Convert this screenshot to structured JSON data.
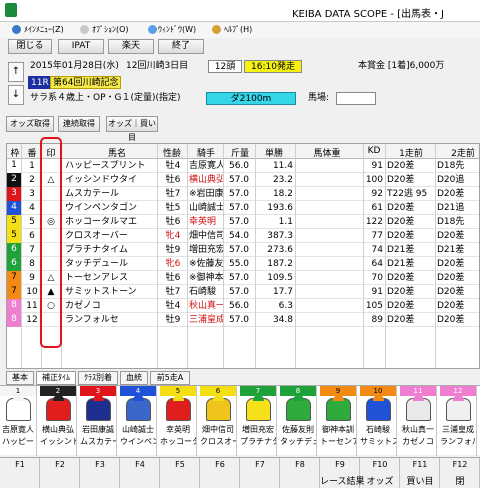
{
  "window": {
    "title": "KEIBA DATA SCOPE - [出馬表・J"
  },
  "menu": {
    "items": [
      "ﾒｲﾝﾒﾆｭｰ(Z)",
      "ｵﾌﾟｼｮﾝ(O)",
      "ｳｨﾝﾄﾞｳ(W)",
      "ﾍﾙﾌﾟ(H)"
    ]
  },
  "toolbar": {
    "close": "閉じる",
    "ipat": "IPAT",
    "rakuten": "楽天",
    "exit": "終了"
  },
  "race": {
    "date": "2015年01月28日(水)",
    "venue": "12回川崎3日目",
    "heads": "12頭",
    "start": "16:10発走",
    "prize": "本賞金 [1着]6,000万",
    "num": "11R",
    "name": "第64回川崎記念",
    "cond": "サラ系４歳上・OP・G１(定量)(指定)",
    "dist": "ダ2100m",
    "baba": "馬場:",
    "up": "↑",
    "down": "↓"
  },
  "subtabs": {
    "odds_get": "オッズ取得",
    "renzoku": "連続取得",
    "odds_buy": "オッズ｜買い目"
  },
  "grid": {
    "headers": [
      "枠",
      "番",
      "印",
      "馬名",
      "性齢",
      "騎手",
      "斤量",
      "単勝",
      "馬体重",
      "KD",
      "1走前",
      "2走前"
    ],
    "rows": [
      {
        "waku": "1",
        "ban": "1",
        "mark": "",
        "name": "ハッピースプリント",
        "sex": "牡4",
        "jockey": "吉原寛人",
        "kin": "56.0",
        "odds": "11.4",
        "kd": "91",
        "r1": "D20差",
        "r2": "D18先"
      },
      {
        "waku": "2",
        "ban": "2",
        "mark": "△",
        "name": "イッシンドウタイ",
        "sex": "牡6",
        "jockey": "横山典弘",
        "kin": "57.0",
        "odds": "23.2",
        "kd": "100",
        "r1": "D20差",
        "r2": "D20追"
      },
      {
        "waku": "3",
        "ban": "3",
        "mark": "",
        "name": "ムスカテール",
        "sex": "牡7",
        "jockey": "※岩田康誠",
        "kin": "57.0",
        "odds": "18.2",
        "kd": "92",
        "r1": "T22逃 95",
        "r2": "D20差"
      },
      {
        "waku": "4",
        "ban": "4",
        "mark": "",
        "name": "ウインペンタゴン",
        "sex": "牡5",
        "jockey": "山崎誠士",
        "kin": "57.0",
        "odds": "193.6",
        "kd": "61",
        "r1": "D20差",
        "r2": "D21追"
      },
      {
        "waku": "5",
        "ban": "5",
        "mark": "◎",
        "name": "ホッコータルマエ",
        "sex": "牡6",
        "jockey": "幸英明",
        "kin": "57.0",
        "odds": "1.1",
        "kd": "122",
        "r1": "D20差",
        "r2": "D18先"
      },
      {
        "waku": "5",
        "ban": "6",
        "mark": "",
        "name": "クロスオーバー",
        "sex": "牝4",
        "jockey": "畑中信司",
        "kin": "54.0",
        "odds": "387.3",
        "kd": "77",
        "r1": "D20差",
        "r2": "D20差"
      },
      {
        "waku": "6",
        "ban": "7",
        "mark": "",
        "name": "プラチナタイム",
        "sex": "牡9",
        "jockey": "増田充宏",
        "kin": "57.0",
        "odds": "273.6",
        "kd": "74",
        "r1": "D21差",
        "r2": "D21差"
      },
      {
        "waku": "6",
        "ban": "8",
        "mark": "",
        "name": "タッチデュール",
        "sex": "牝6",
        "jockey": "※佐藤友則",
        "kin": "55.0",
        "odds": "187.2",
        "kd": "64",
        "r1": "D21差",
        "r2": "D20差"
      },
      {
        "waku": "7",
        "ban": "9",
        "mark": "△",
        "name": "トーセンアレス",
        "sex": "牡6",
        "jockey": "※御神本訓",
        "kin": "57.0",
        "odds": "109.5",
        "kd": "70",
        "r1": "D20差",
        "r2": "D20差"
      },
      {
        "waku": "7",
        "ban": "10",
        "mark": "▲",
        "name": "サミットストーン",
        "sex": "牡7",
        "jockey": "石崎駿",
        "kin": "57.0",
        "odds": "17.7",
        "kd": "91",
        "r1": "D20差",
        "r2": "D20差"
      },
      {
        "waku": "8",
        "ban": "11",
        "mark": "○",
        "name": "カゼノコ",
        "sex": "牡4",
        "jockey": "秋山真一",
        "kin": "56.0",
        "odds": "6.3",
        "kd": "105",
        "r1": "D20差",
        "r2": "D20差"
      },
      {
        "waku": "8",
        "ban": "12",
        "mark": "",
        "name": "ランフォルセ",
        "sex": "牡9",
        "jockey": "三浦皇成",
        "kin": "57.0",
        "odds": "34.8",
        "kd": "89",
        "r1": "D20差",
        "r2": "D20差"
      }
    ]
  },
  "bottom_tabs": [
    "基本",
    "補正ﾀｲﾑ",
    "ｸﾗｽ別着",
    "血統",
    "前5走A"
  ],
  "silks": [
    {
      "n": "1",
      "jockey": "吉原寛人",
      "horse": "ハッピー"
    },
    {
      "n": "2",
      "jockey": "横山典弘",
      "horse": "イッシンド"
    },
    {
      "n": "3",
      "jockey": "岩田康誠",
      "horse": "ムスカテー"
    },
    {
      "n": "4",
      "jockey": "山崎誠士",
      "horse": "ウインペン"
    },
    {
      "n": "5",
      "jockey": "幸英明",
      "horse": "ホッコータ"
    },
    {
      "n": "6",
      "jockey": "畑中信司",
      "horse": "クロスオー"
    },
    {
      "n": "7",
      "jockey": "増田充宏",
      "horse": "プラチナタ"
    },
    {
      "n": "8",
      "jockey": "佐藤友則",
      "horse": "タッチデュ"
    },
    {
      "n": "9",
      "jockey": "御神本訓",
      "horse": "トーセンア"
    },
    {
      "n": "10",
      "jockey": "石崎駿",
      "horse": "サミットス"
    },
    {
      "n": "11",
      "jockey": "秋山真一",
      "horse": "カゼノコ"
    },
    {
      "n": "12",
      "jockey": "三浦皇成",
      "horse": "ランフォル"
    }
  ],
  "fkeys": [
    {
      "n": "F1",
      "l": ""
    },
    {
      "n": "F2",
      "l": ""
    },
    {
      "n": "F3",
      "l": ""
    },
    {
      "n": "F4",
      "l": ""
    },
    {
      "n": "F5",
      "l": ""
    },
    {
      "n": "F6",
      "l": ""
    },
    {
      "n": "F7",
      "l": ""
    },
    {
      "n": "F8",
      "l": ""
    },
    {
      "n": "F9",
      "l": "レース結果"
    },
    {
      "n": "F10",
      "l": "オッズ"
    },
    {
      "n": "F11",
      "l": "買い目"
    },
    {
      "n": "F12",
      "l": "閉"
    }
  ],
  "colors": {
    "waku": {
      "1": "#ffffff",
      "2": "#111111",
      "3": "#e0141b",
      "4": "#1f52d6",
      "5": "#f3df14",
      "6": "#1ea23a",
      "7": "#f28a14",
      "8": "#f07ed0"
    },
    "waku_text": {
      "1": "#000000",
      "2": "#ffffff",
      "3": "#ffffff",
      "4": "#ffffff",
      "5": "#000000",
      "6": "#ffffff",
      "7": "#000000",
      "8": "#ffffff"
    },
    "highlight": "#e1141b",
    "silk": [
      "#ffffff",
      "#e01e1e",
      "#1f2f8f",
      "#3a67c9",
      "#e01e1e",
      "#f0c41b",
      "#f6e01a",
      "#2faa3c",
      "#2faa3c",
      "#1f52d6",
      "#e9e9e9",
      "#f0f0f0"
    ],
    "silk_cap": [
      "#f5f5f5",
      "#222222",
      "#e0141b",
      "#1f52d6",
      "#f3df14",
      "#f3df14",
      "#1ea23a",
      "#1ea23a",
      "#f28a14",
      "#f28a14",
      "#f07ed0",
      "#f07ed0"
    ]
  }
}
